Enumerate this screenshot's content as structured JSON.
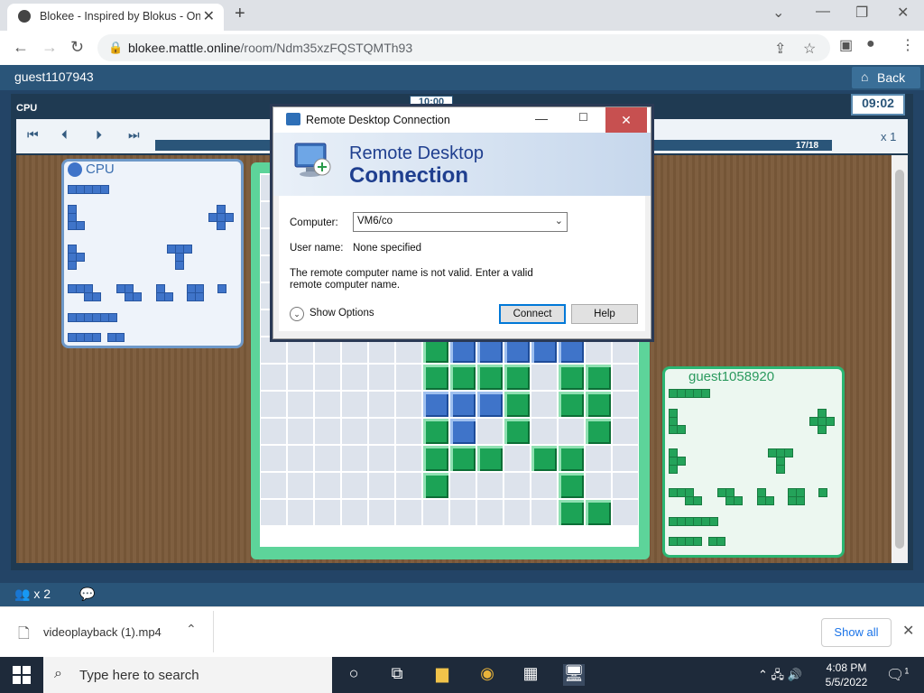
{
  "browser": {
    "tab_title": "Blokee - Inspired by Blokus - Onl",
    "url_host": "blokee.mattle.online",
    "url_path": "/room/Ndm35xzFQSTQMTh93"
  },
  "app": {
    "username": "guest1107943",
    "back_label": "Back",
    "top_timer": "10:00",
    "cpu_label": "CPU",
    "turn_timer": "09:02",
    "progress": "17/18",
    "progress_fraction": 0.94,
    "speed": "x 1",
    "players_count": "x 2",
    "cpu_panel_name": "CPU",
    "guest_panel_name": "guest1058920"
  },
  "board": {
    "rows": [
      "..............",
      "..............",
      "..............",
      "..............",
      "..............",
      "......GBGGGG..",
      "......GBBBBB..",
      "......GGGG.GG.",
      "......BBBG.GG.",
      "......GB.G..G.",
      "......GGG.GG..",
      "......G....G..",
      "...........GG."
    ]
  },
  "rdp": {
    "title": "Remote Desktop Connection",
    "banner_line1": "Remote Desktop",
    "banner_line2": "Connection",
    "computer_label": "Computer:",
    "computer_value": "VM6/co",
    "user_label": "User name:",
    "user_value": "None specified",
    "error_text": "The remote computer name is not valid. Enter a valid remote computer name.",
    "show_options": "Show Options",
    "connect_label": "Connect",
    "help_label": "Help"
  },
  "downloads": {
    "file_name": "videoplayback (1).mp4",
    "show_all": "Show all"
  },
  "taskbar": {
    "search_placeholder": "Type here to search",
    "time": "4:08 PM",
    "date": "5/5/2022",
    "notif_count": "1"
  },
  "colors": {
    "app_bar": "#2a5579",
    "blue_piece": "#3f74c9",
    "green_piece": "#1ca356"
  }
}
